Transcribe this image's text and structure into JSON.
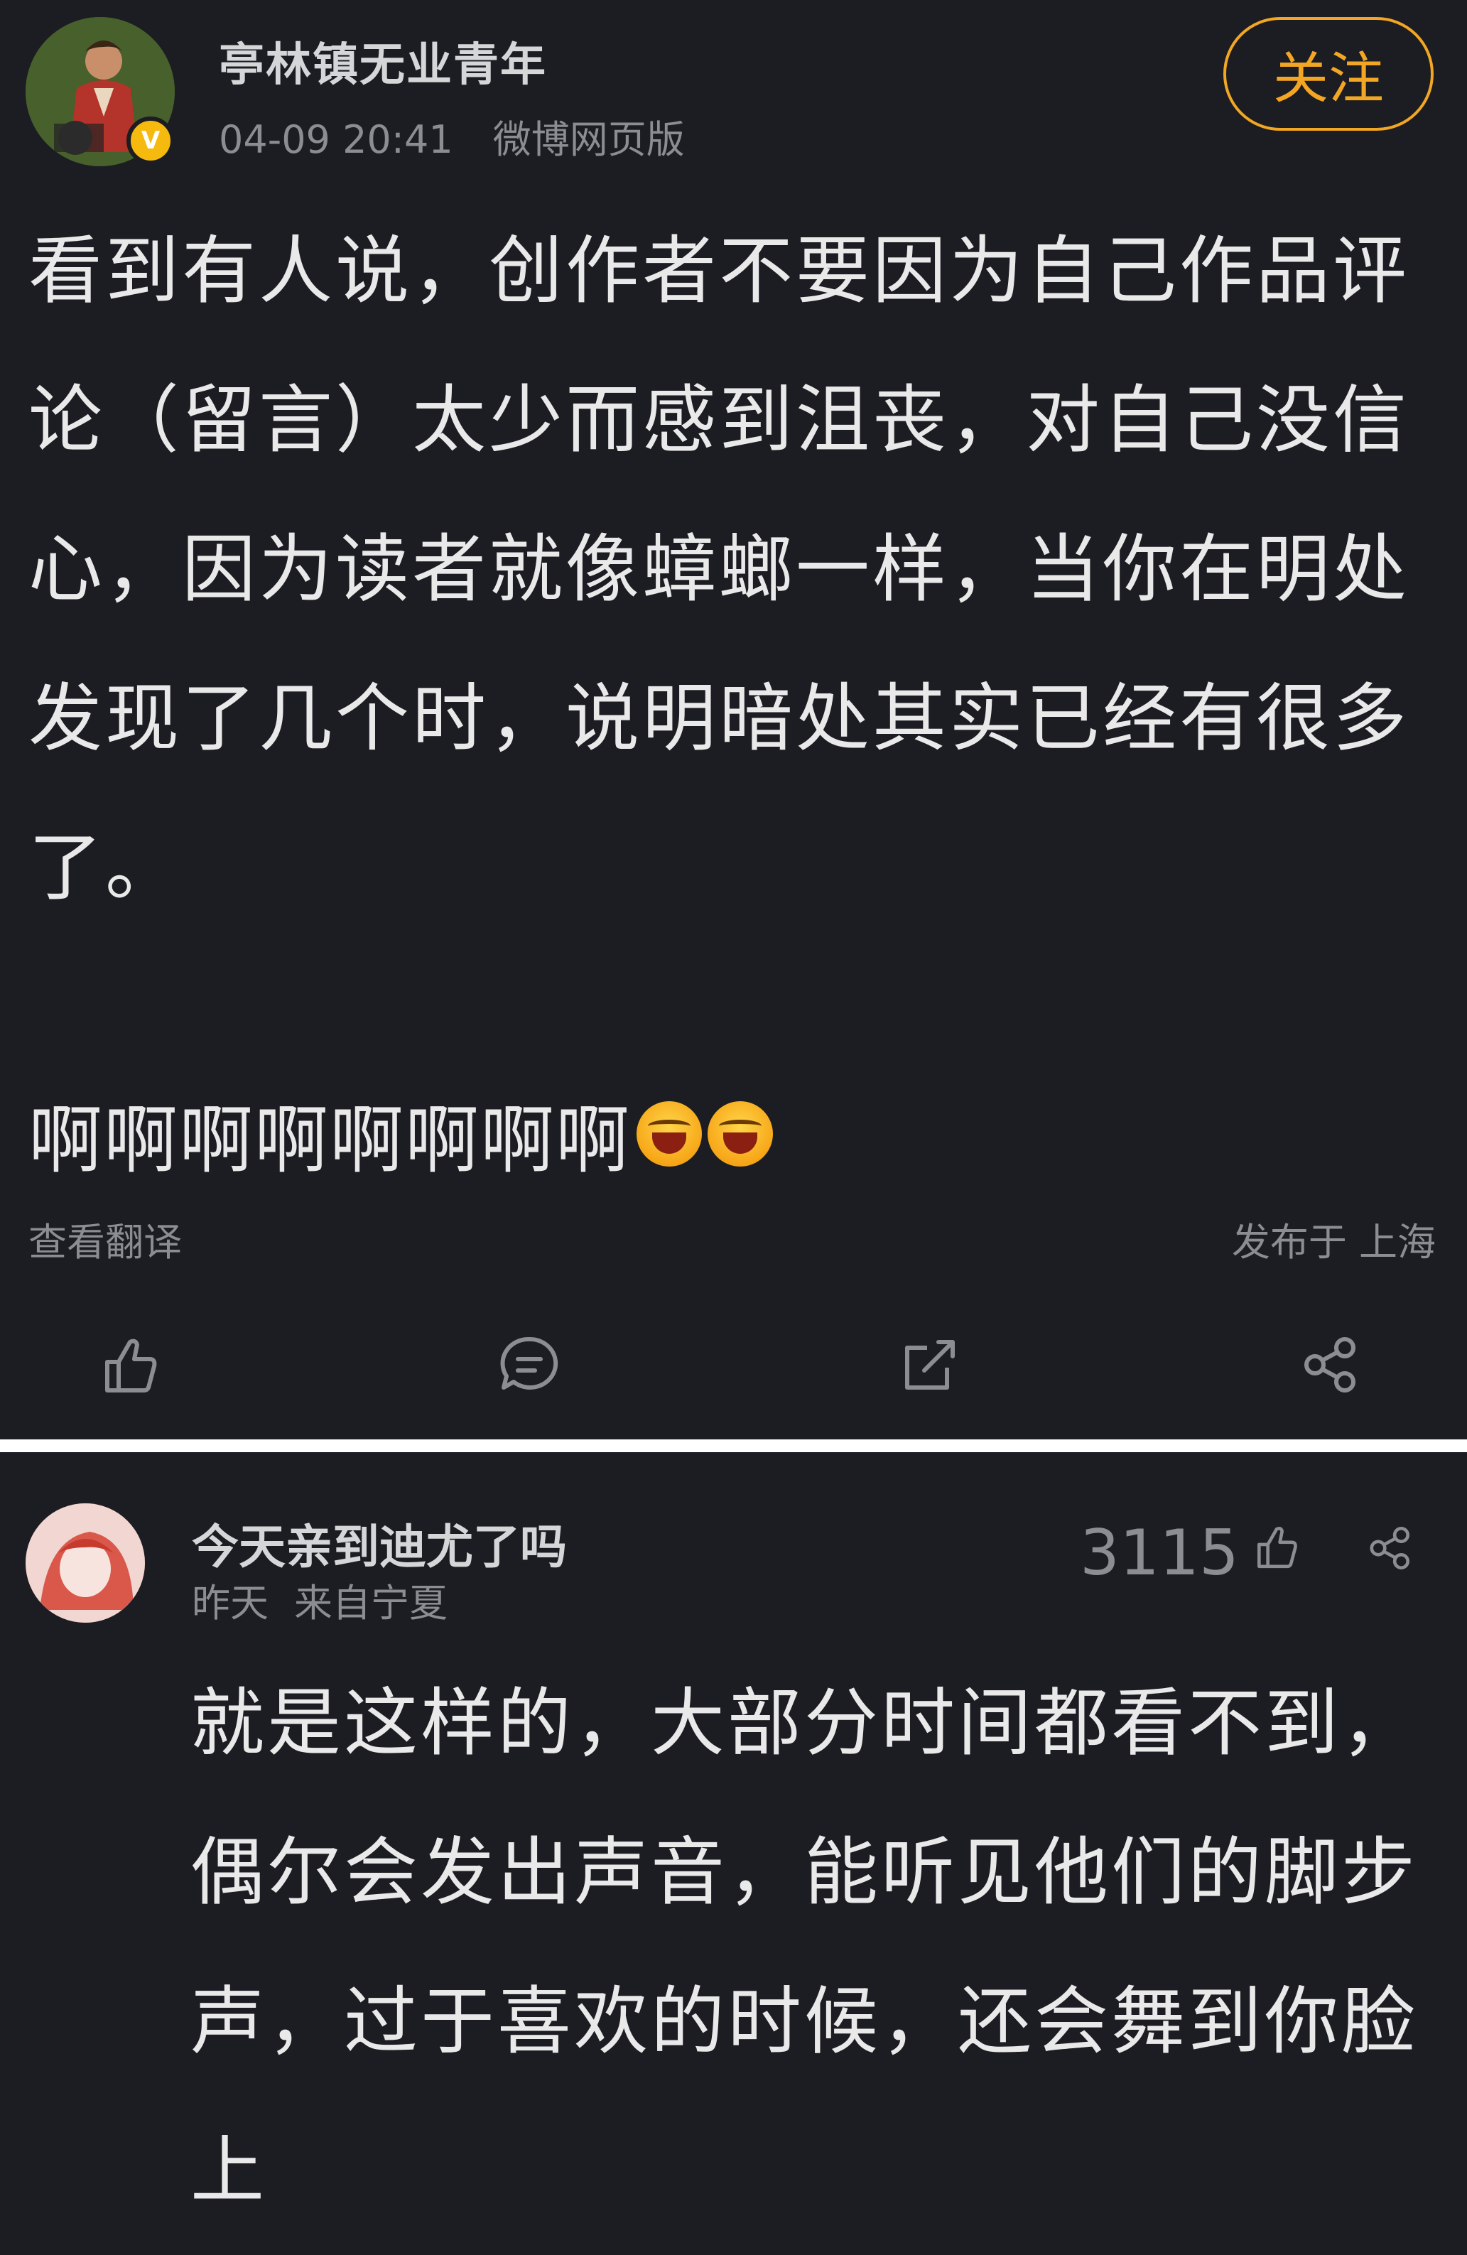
{
  "post": {
    "author": "亭林镇无业青年",
    "timestamp": "04-09 20:41",
    "source": "微博网页版",
    "follow_label": "关注",
    "verified_badge": "V",
    "body": "看到有人说，创作者不要因为自己作品评论（留言）太少而感到沮丧，对自己没信心，因为读者就像蟑螂一样，当你在明处发现了几个时，说明暗处其实已经有很多了。",
    "exclaim": "啊啊啊啊啊啊啊啊",
    "translate_label": "查看翻译",
    "location_label": "发布于 上海",
    "actions": [
      "like-icon",
      "comment-icon",
      "repost-icon",
      "share-icon"
    ]
  },
  "reply": {
    "author": "今天亲到迪尤了吗",
    "time": "昨天",
    "from": "来自宁夏",
    "likes": "3115",
    "body": "就是这样的，大部分时间都看不到，偶尔会发出声音，能听见他们的脚步声，过于喜欢的时候，还会舞到你脸上"
  },
  "colors": {
    "background": "#1b1d22",
    "accent": "#f2a623",
    "muted_text": "#8b8d92",
    "divider": "#ffffff"
  }
}
